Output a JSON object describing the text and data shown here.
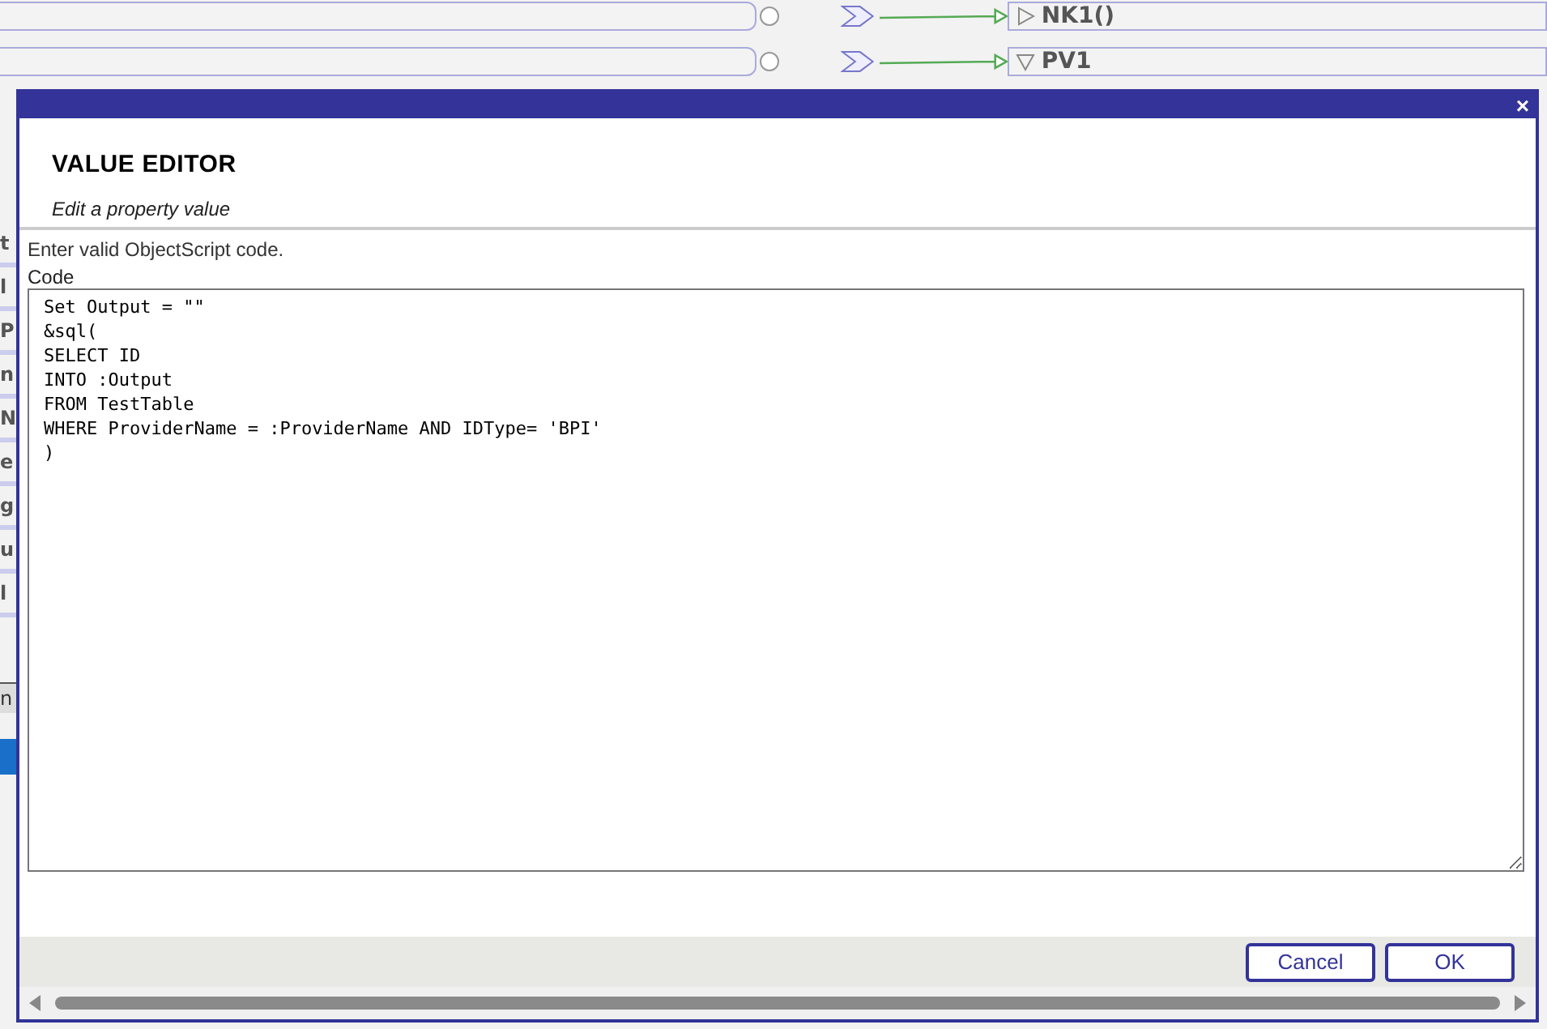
{
  "background": {
    "nodes": [
      {
        "label": "NK1()",
        "kind": "collapsed"
      },
      {
        "label": "PV1",
        "kind": "expanded"
      }
    ],
    "side_labels": [
      {
        "label": "t"
      },
      {
        "label": "l"
      },
      {
        "label": "P"
      },
      {
        "label": "n"
      },
      {
        "label": "N"
      },
      {
        "label": "e"
      },
      {
        "label": "g"
      },
      {
        "label": "u"
      },
      {
        "label": "l"
      }
    ],
    "side_tab": "n"
  },
  "dialog": {
    "close": "×",
    "title": "VALUE EDITOR",
    "subtitle": "Edit a property value",
    "hint": "Enter valid ObjectScript code.",
    "field_label": "Code",
    "code": [
      "Set Output = \"\"",
      "&sql(",
      "SELECT ID",
      "INTO :Output",
      "FROM TestTable",
      "WHERE ProviderName = :ProviderName AND IDType= 'BPI'",
      ")"
    ],
    "buttons": [
      "Cancel",
      "OK"
    ]
  }
}
